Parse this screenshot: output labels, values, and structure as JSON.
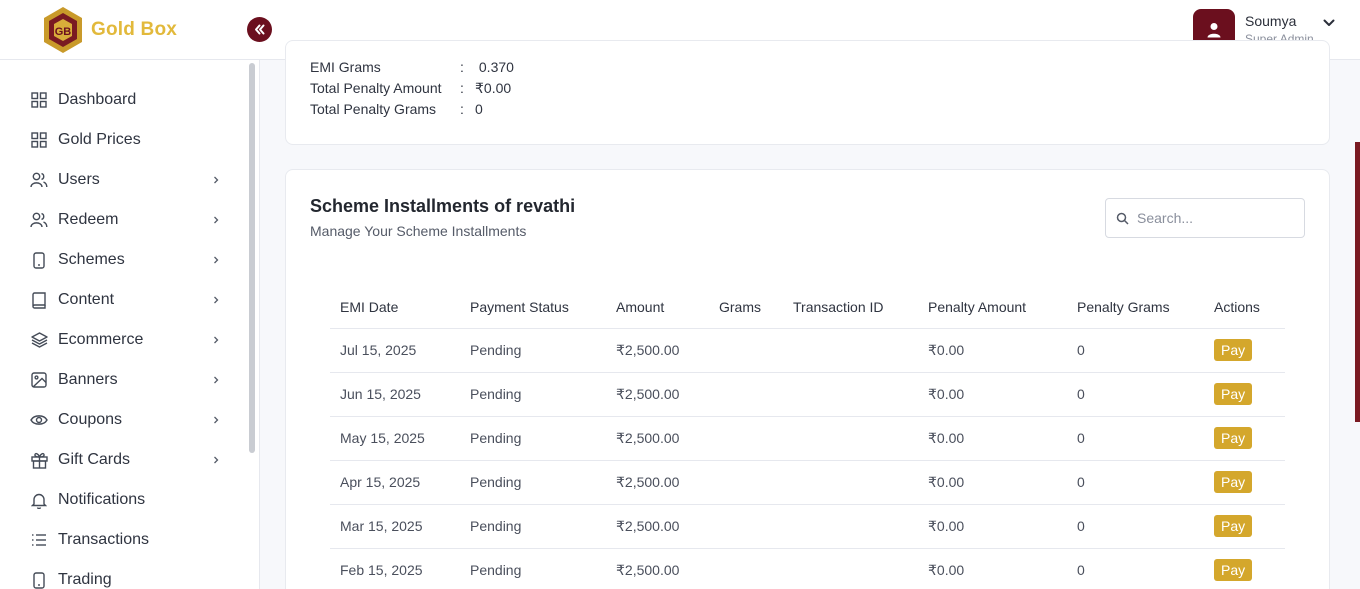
{
  "brand": {
    "name": "Gold Box",
    "logo_letters": "GB"
  },
  "user": {
    "name": "Soumya",
    "role": "Super Admin"
  },
  "sidebar": {
    "items": [
      {
        "label": "Dashboard",
        "icon": "grid-icon",
        "has_children": false
      },
      {
        "label": "Gold Prices",
        "icon": "grid-icon",
        "has_children": false
      },
      {
        "label": "Users",
        "icon": "users-icon",
        "has_children": true
      },
      {
        "label": "Redeem",
        "icon": "users-icon",
        "has_children": true
      },
      {
        "label": "Schemes",
        "icon": "phone-icon",
        "has_children": true
      },
      {
        "label": "Content",
        "icon": "book-icon",
        "has_children": true
      },
      {
        "label": "Ecommerce",
        "icon": "layers-icon",
        "has_children": true
      },
      {
        "label": "Banners",
        "icon": "image-icon",
        "has_children": true
      },
      {
        "label": "Coupons",
        "icon": "eye-icon",
        "has_children": true
      },
      {
        "label": "Gift Cards",
        "icon": "gift-icon",
        "has_children": true
      },
      {
        "label": "Notifications",
        "icon": "bell-icon",
        "has_children": false
      },
      {
        "label": "Transactions",
        "icon": "list-icon",
        "has_children": false
      },
      {
        "label": "Trading",
        "icon": "phone-icon",
        "has_children": false
      }
    ]
  },
  "summary": {
    "rows": [
      {
        "label": "EMI Grams",
        "sep": ":",
        "value": " 0.370"
      },
      {
        "label": "Total Penalty Amount",
        "sep": ":",
        "value": "₹0.00"
      },
      {
        "label": "Total Penalty Grams",
        "sep": ":",
        "value": "0"
      }
    ]
  },
  "installments": {
    "title": "Scheme Installments of revathi",
    "subtitle": "Manage Your Scheme Installments",
    "search_placeholder": "Search...",
    "columns": [
      "EMI Date",
      "Payment Status",
      "Amount",
      "Grams",
      "Transaction ID",
      "Penalty Amount",
      "Penalty Grams",
      "Actions"
    ],
    "rows": [
      {
        "date": "Jul 15, 2025",
        "status": "Pending",
        "amount": "₹2,500.00",
        "grams": "",
        "txn": "",
        "penalty_amount": "₹0.00",
        "penalty_grams": "0",
        "action": "Pay"
      },
      {
        "date": "Jun 15, 2025",
        "status": "Pending",
        "amount": "₹2,500.00",
        "grams": "",
        "txn": "",
        "penalty_amount": "₹0.00",
        "penalty_grams": "0",
        "action": "Pay"
      },
      {
        "date": "May 15, 2025",
        "status": "Pending",
        "amount": "₹2,500.00",
        "grams": "",
        "txn": "",
        "penalty_amount": "₹0.00",
        "penalty_grams": "0",
        "action": "Pay"
      },
      {
        "date": "Apr 15, 2025",
        "status": "Pending",
        "amount": "₹2,500.00",
        "grams": "",
        "txn": "",
        "penalty_amount": "₹0.00",
        "penalty_grams": "0",
        "action": "Pay"
      },
      {
        "date": "Mar 15, 2025",
        "status": "Pending",
        "amount": "₹2,500.00",
        "grams": "",
        "txn": "",
        "penalty_amount": "₹0.00",
        "penalty_grams": "0",
        "action": "Pay"
      },
      {
        "date": "Feb 15, 2025",
        "status": "Pending",
        "amount": "₹2,500.00",
        "grams": "",
        "txn": "",
        "penalty_amount": "₹0.00",
        "penalty_grams": "0",
        "action": "Pay"
      }
    ]
  },
  "colors": {
    "brand_gold": "#e2b93b",
    "accent_maroon": "#6b0f1e",
    "pending_red": "#d0373f",
    "pay_button": "#d4a72c"
  }
}
